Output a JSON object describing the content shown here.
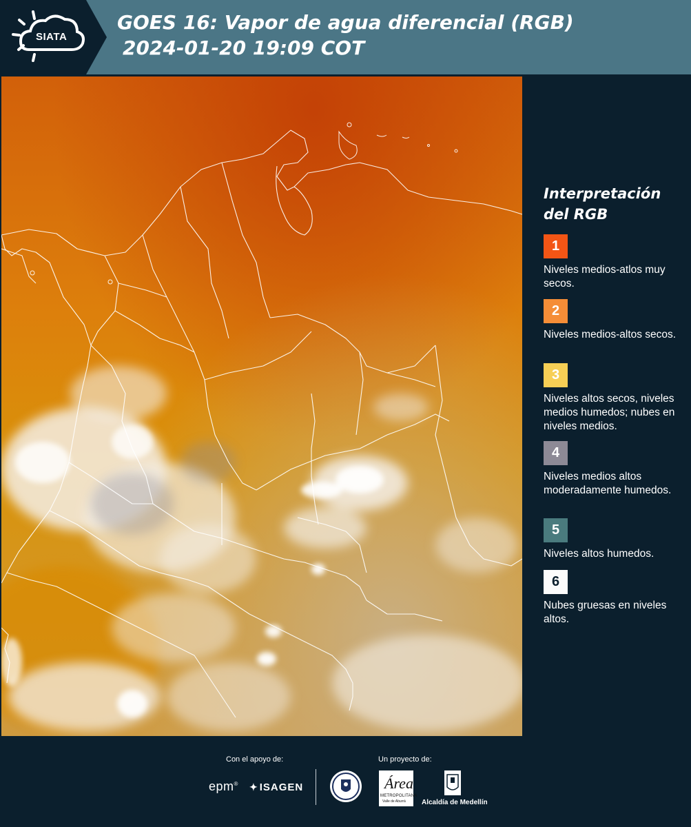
{
  "header": {
    "logo": "SIATA",
    "title_line1": "GOES 16: Vapor de agua diferencial (RGB)",
    "title_line2": "2024-01-20 19:09 COT"
  },
  "legend": {
    "title_line1": "Interpretación",
    "title_line2": "del RGB",
    "items": [
      {
        "number": "1",
        "color": "#f35515",
        "description": "Niveles medios-atlos muy secos."
      },
      {
        "number": "2",
        "color": "#f58d37",
        "description": "Niveles medios-altos secos."
      },
      {
        "number": "3",
        "color": "#f7cf55",
        "description": "Niveles altos secos, niveles medios humedos; nubes en niveles medios."
      },
      {
        "number": "4",
        "color": "#8d8a96",
        "description": "Niveles medios altos moderadamente humedos."
      },
      {
        "number": "5",
        "color": "#4a7b7e",
        "description": "Niveles altos humedos."
      },
      {
        "number": "6",
        "color": "#fbfbfb",
        "description": "Nubes gruesas en niveles altos."
      }
    ]
  },
  "footer": {
    "support_label": "Con el apoyo de:",
    "project_label": "Un proyecto de:",
    "sponsor_1": "epm",
    "sponsor_2": "ISAGEN",
    "partner_area": "Área",
    "partner_area_sub1": "METROPOLITANA",
    "partner_area_sub2": "Valle de Aburrá",
    "partner_alcaldia": "Alcaldía de Medellín"
  },
  "map": {
    "image": "satellite-water-vapor-rgb",
    "background_color": "#d8790a",
    "dry_color": "#c84a05",
    "moist_color": "#c7a24d",
    "cloud_color": "#f4eee6",
    "border_color": "#ffffff"
  }
}
